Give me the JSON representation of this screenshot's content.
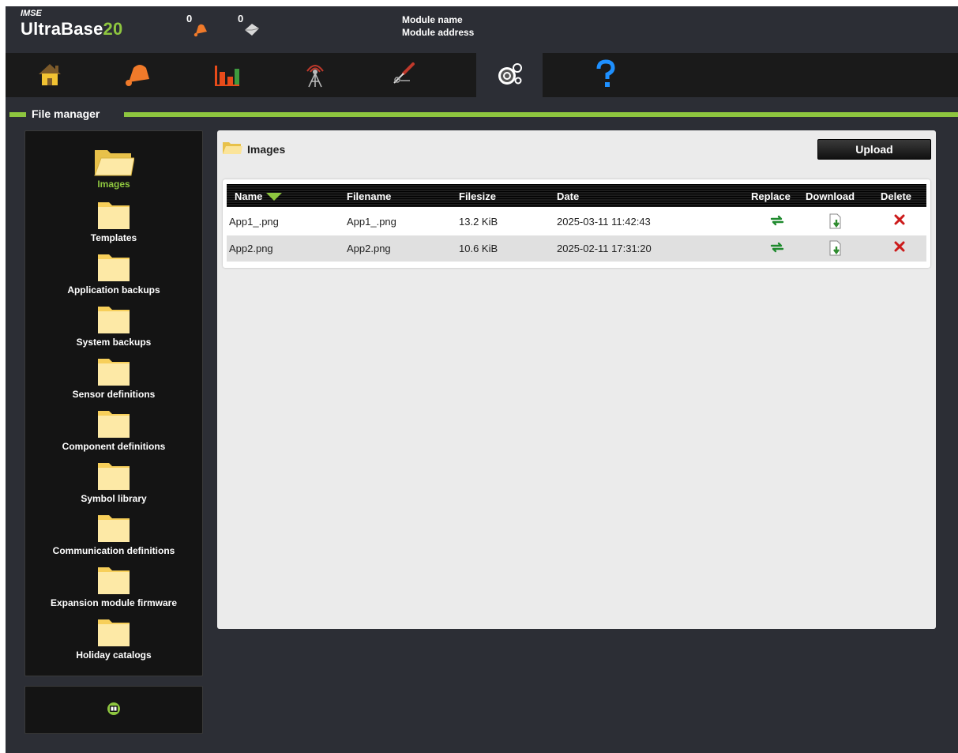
{
  "header": {
    "brand_small": "IMSE",
    "brand_name": "UltraBase",
    "brand_number": "20",
    "alarm_count": "0",
    "message_count": "0",
    "module_name": "Module name",
    "module_address": "Module address"
  },
  "nav": {
    "items": [
      {
        "name": "home",
        "icon": "house-icon"
      },
      {
        "name": "alarms",
        "icon": "bell-icon"
      },
      {
        "name": "charts",
        "icon": "bar-chart-icon"
      },
      {
        "name": "communication",
        "icon": "antenna-icon"
      },
      {
        "name": "tools",
        "icon": "screwdriver-icon"
      },
      {
        "name": "settings",
        "icon": "gears-icon",
        "active": true
      },
      {
        "name": "help",
        "icon": "question-icon"
      }
    ]
  },
  "section": {
    "title": "File manager"
  },
  "sidebar": {
    "folders": [
      {
        "label": "Images",
        "active": true
      },
      {
        "label": "Templates"
      },
      {
        "label": "Application backups"
      },
      {
        "label": "System backups"
      },
      {
        "label": "Sensor definitions"
      },
      {
        "label": "Component definitions"
      },
      {
        "label": "Symbol library"
      },
      {
        "label": "Communication definitions"
      },
      {
        "label": "Expansion module firmware"
      },
      {
        "label": "Holiday catalogs"
      }
    ],
    "footer_icon": "info-book-icon"
  },
  "panel": {
    "title": "Images",
    "upload_label": "Upload"
  },
  "table": {
    "headers": {
      "name": "Name",
      "filename": "Filename",
      "filesize": "Filesize",
      "date": "Date",
      "replace": "Replace",
      "download": "Download",
      "delete": "Delete"
    },
    "sort_column": "Name",
    "rows": [
      {
        "name": "App1_.png",
        "filename": "App1_.png",
        "filesize": "13.2 KiB",
        "date": "2025-03-11 11:42:43"
      },
      {
        "name": "App2.png",
        "filename": "App2.png",
        "filesize": "10.6 KiB",
        "date": "2025-02-11 17:31:20"
      }
    ]
  },
  "colors": {
    "accent": "#8ec63f",
    "background": "#2c2e35",
    "nav": "#1a1a1a",
    "delete": "#cc1a1a",
    "replace": "#1f8a2e"
  }
}
